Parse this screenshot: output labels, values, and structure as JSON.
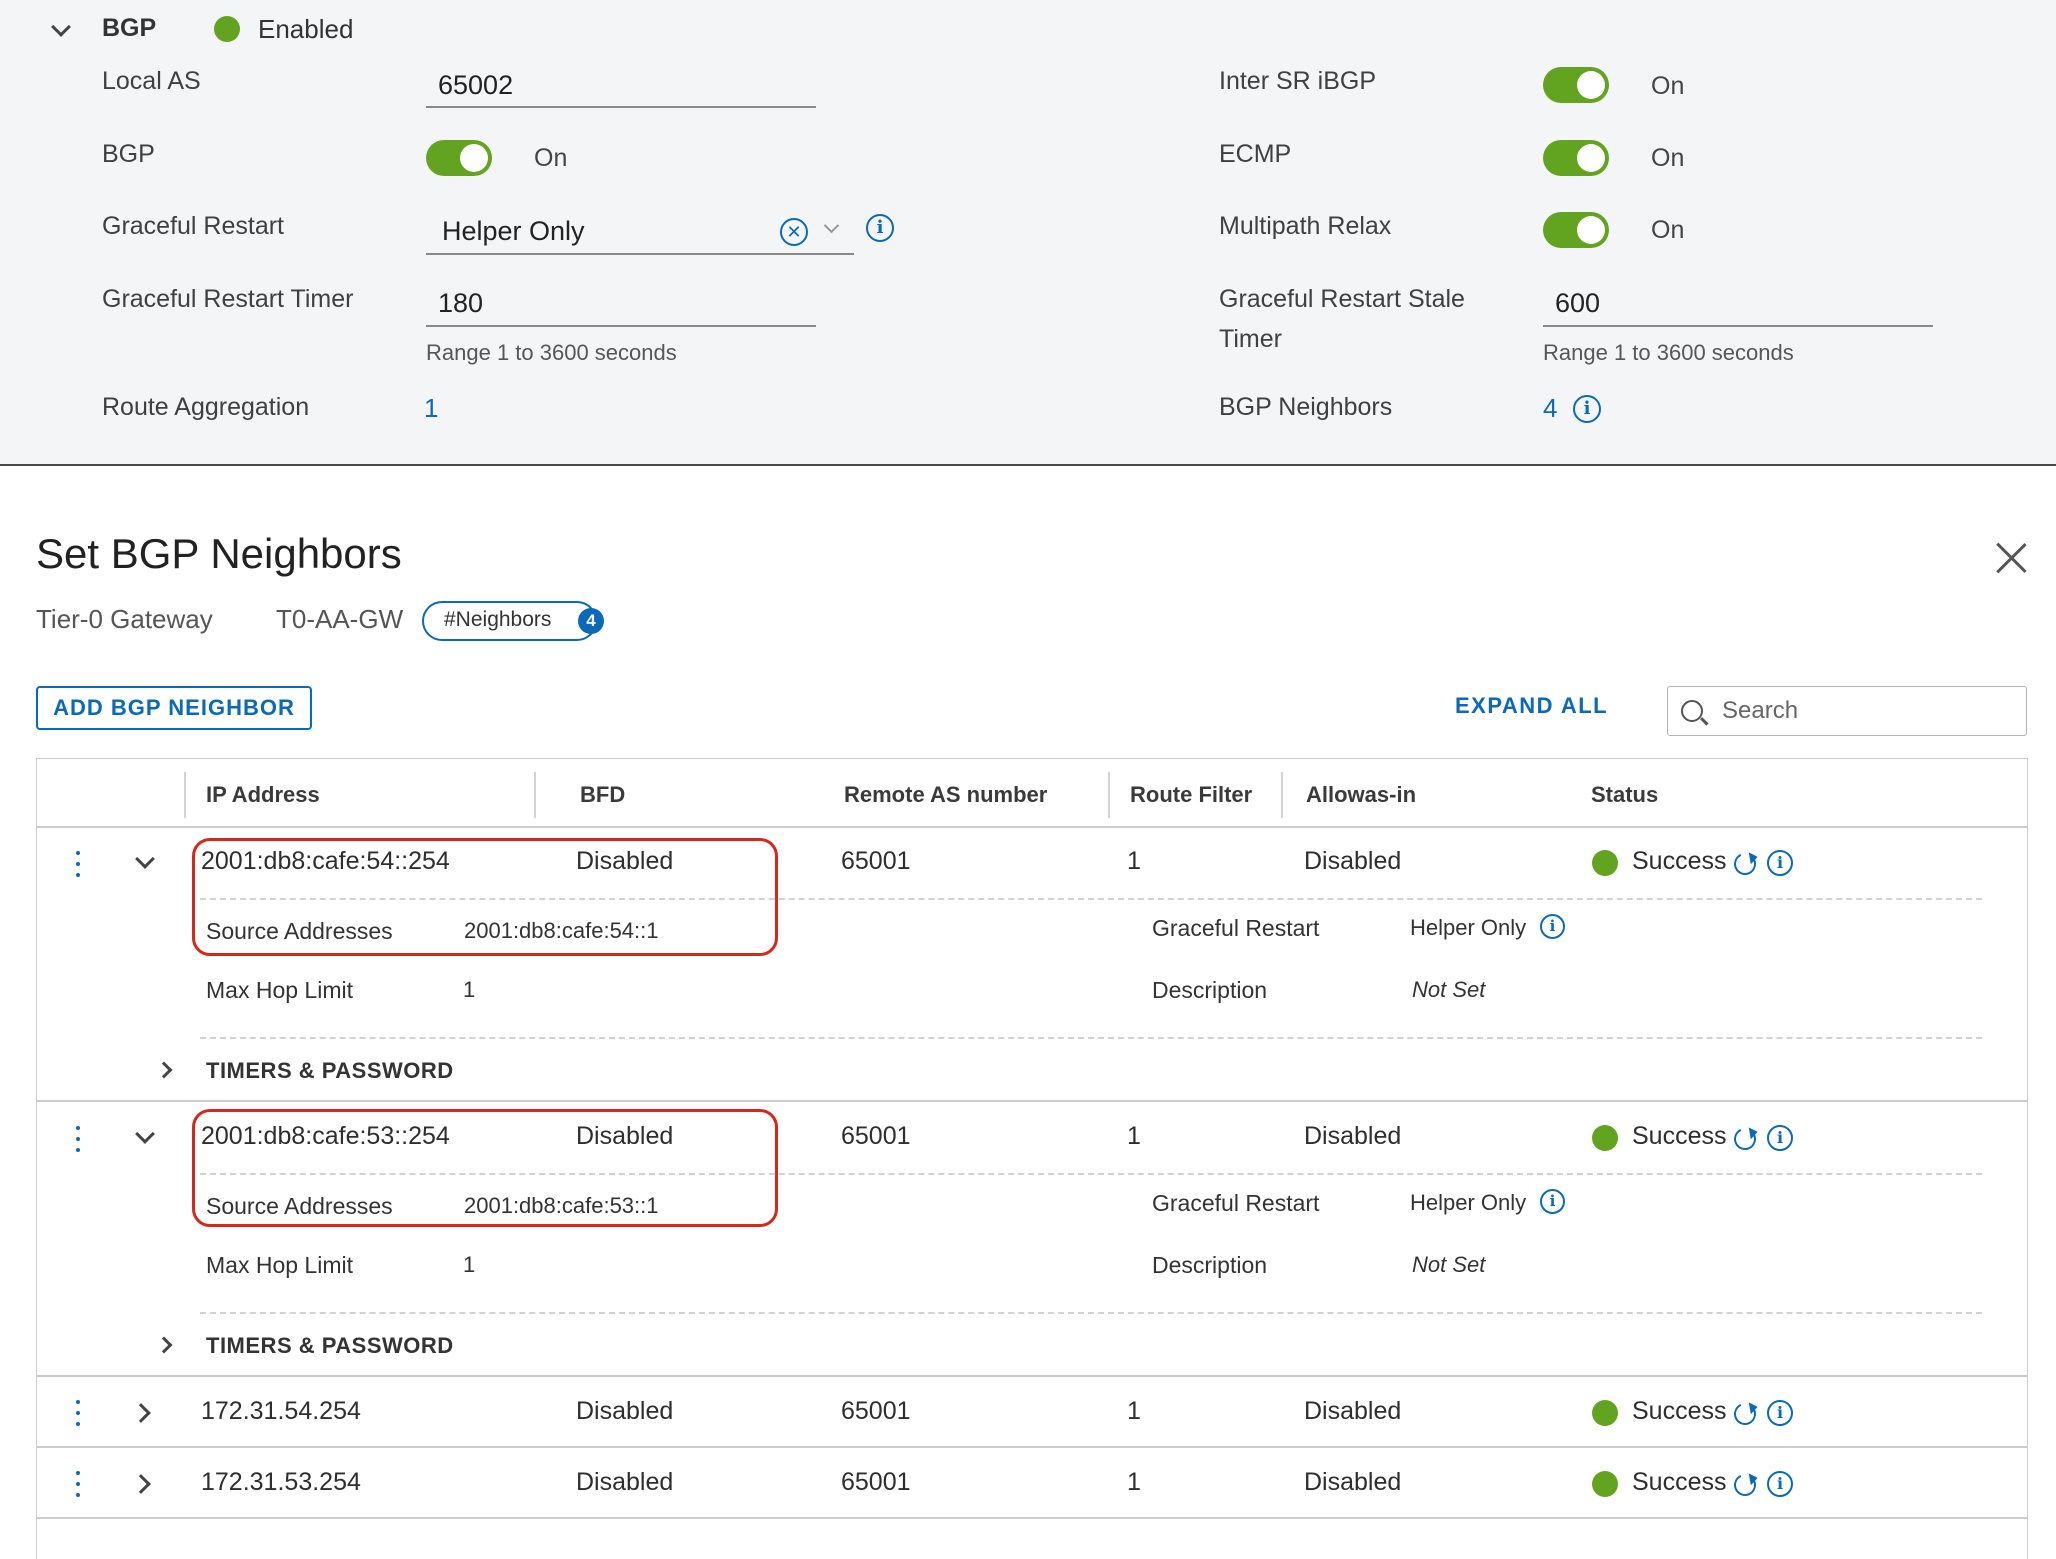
{
  "bgp_panel": {
    "section_title": "BGP",
    "status_text": "Enabled",
    "left_fields": {
      "local_as_label": "Local AS",
      "local_as_value": "65002",
      "bgp_label": "BGP",
      "bgp_toggle_text": "On",
      "graceful_restart_label": "Graceful Restart",
      "graceful_restart_value": "Helper Only",
      "graceful_restart_timer_label": "Graceful Restart Timer",
      "graceful_restart_timer_value": "180",
      "graceful_restart_timer_hint": "Range 1 to 3600 seconds",
      "route_aggregation_label": "Route Aggregation",
      "route_aggregation_value": "1"
    },
    "right_fields": {
      "inter_sr_label": "Inter SR iBGP",
      "inter_sr_toggle_text": "On",
      "ecmp_label": "ECMP",
      "ecmp_toggle_text": "On",
      "multipath_label": "Multipath Relax",
      "multipath_toggle_text": "On",
      "stale_timer_label_line1": "Graceful Restart Stale",
      "stale_timer_label_line2": "Timer",
      "stale_timer_value": "600",
      "stale_timer_hint": "Range 1 to 3600 seconds",
      "neighbors_label": "BGP Neighbors",
      "neighbors_value": "4"
    }
  },
  "modal": {
    "title": "Set BGP Neighbors",
    "gateway_type": "Tier-0 Gateway",
    "gateway_name": "T0-AA-GW",
    "neighbors_badge_label": "#Neighbors",
    "neighbors_badge_count": "4",
    "add_button": "ADD BGP NEIGHBOR",
    "expand_all": "EXPAND ALL",
    "search_placeholder": "Search"
  },
  "grid": {
    "columns": {
      "ip": "IP Address",
      "bfd": "BFD",
      "remote_as": "Remote AS number",
      "route_filter": "Route Filter",
      "allowas": "Allowas-in",
      "status": "Status"
    },
    "rows": [
      {
        "ip": "2001:db8:cafe:54::254",
        "bfd": "Disabled",
        "remote_as": "65001",
        "route_filter": "1",
        "allowas": "Disabled",
        "status": "Success",
        "expanded": true,
        "source_addresses_label": "Source Addresses",
        "source_addresses": "2001:db8:cafe:54::1",
        "max_hop_label": "Max Hop Limit",
        "max_hop": "1",
        "graceful_restart_label": "Graceful Restart",
        "graceful_restart": "Helper Only",
        "description_label": "Description",
        "description": "Not Set",
        "timers_label": "TIMERS & PASSWORD"
      },
      {
        "ip": "2001:db8:cafe:53::254",
        "bfd": "Disabled",
        "remote_as": "65001",
        "route_filter": "1",
        "allowas": "Disabled",
        "status": "Success",
        "expanded": true,
        "source_addresses_label": "Source Addresses",
        "source_addresses": "2001:db8:cafe:53::1",
        "max_hop_label": "Max Hop Limit",
        "max_hop": "1",
        "graceful_restart_label": "Graceful Restart",
        "graceful_restart": "Helper Only",
        "description_label": "Description",
        "description": "Not Set",
        "timers_label": "TIMERS & PASSWORD"
      },
      {
        "ip": "172.31.54.254",
        "bfd": "Disabled",
        "remote_as": "65001",
        "route_filter": "1",
        "allowas": "Disabled",
        "status": "Success",
        "expanded": false
      },
      {
        "ip": "172.31.53.254",
        "bfd": "Disabled",
        "remote_as": "65001",
        "route_filter": "1",
        "allowas": "Disabled",
        "status": "Success",
        "expanded": false
      }
    ]
  },
  "colors": {
    "accent": "#0a6ab8",
    "success": "#62a420",
    "highlight": "#d7261b"
  }
}
